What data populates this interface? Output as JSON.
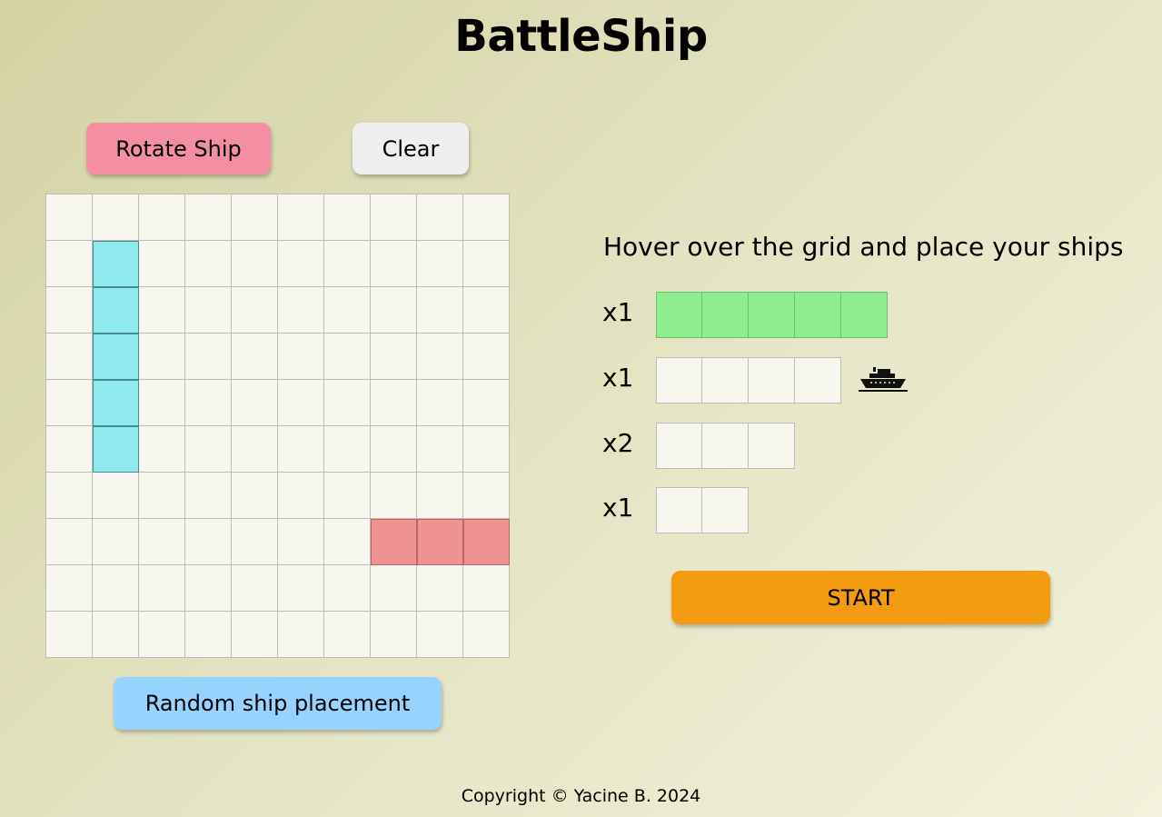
{
  "title": "BattleShip",
  "buttons": {
    "rotate": "Rotate Ship",
    "clear": "Clear",
    "random": "Random ship placement",
    "start": "START"
  },
  "instructions": "Hover over the grid and place your ships",
  "grid": {
    "rows": 10,
    "cols": 10,
    "placed_ships": [
      {
        "orientation": "vertical",
        "cells": [
          [
            1,
            1
          ],
          [
            2,
            1
          ],
          [
            3,
            1
          ],
          [
            4,
            1
          ],
          [
            5,
            1
          ]
        ],
        "color": "#8fe9ef"
      },
      {
        "orientation": "horizontal",
        "cells": [
          [
            7,
            7
          ],
          [
            7,
            8
          ],
          [
            7,
            9
          ]
        ],
        "color": "#ef9292"
      }
    ]
  },
  "fleet": [
    {
      "count": "x1",
      "size": 5,
      "selected": true
    },
    {
      "count": "x1",
      "size": 4,
      "selected": false,
      "icon": "ship-icon"
    },
    {
      "count": "x2",
      "size": 3,
      "selected": false
    },
    {
      "count": "x1",
      "size": 2,
      "selected": false
    }
  ],
  "colors": {
    "rotate_button": "#f48fa3",
    "clear_button": "#efefef",
    "random_button": "#96d4fe",
    "start_button": "#f39c12",
    "selected_ship": "#8fec8f"
  },
  "footer": "Copyright © Yacine B. 2024"
}
